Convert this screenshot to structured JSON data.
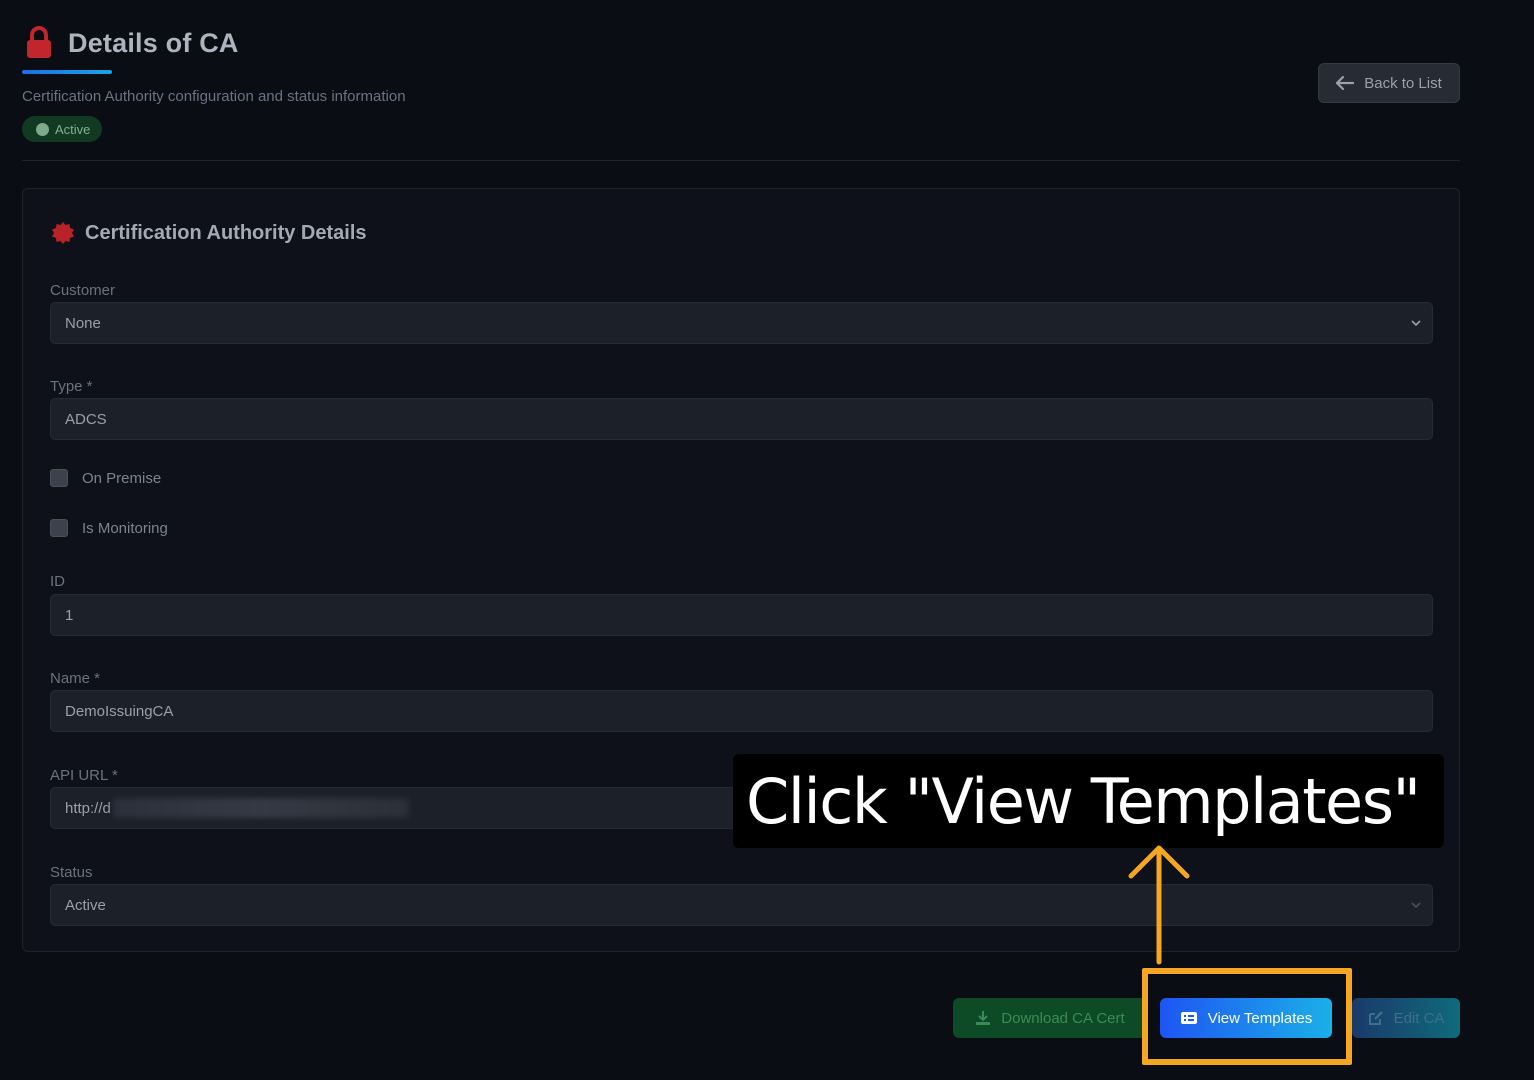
{
  "header": {
    "title": "Details of CA",
    "subtitle": "Certification Authority configuration and status information",
    "status_badge": "Active",
    "back_button": "Back to List"
  },
  "card": {
    "title": "Certification Authority Details",
    "fields": {
      "customer": {
        "label": "Customer",
        "value": "None"
      },
      "type": {
        "label": "Type *",
        "value": "ADCS"
      },
      "on_premise": {
        "label": "On Premise"
      },
      "is_monitoring": {
        "label": "Is Monitoring"
      },
      "id": {
        "label": "ID",
        "value": "1"
      },
      "name": {
        "label": "Name *",
        "value": "DemoIssuingCA"
      },
      "api_url": {
        "label": "API URL *",
        "value": "http://d"
      },
      "status": {
        "label": "Status",
        "value": "Active"
      }
    }
  },
  "actions": {
    "download": "Download CA Cert",
    "templates": "View Templates",
    "edit": "Edit CA"
  },
  "annotation": {
    "callout_text": "Click \"View Templates\""
  },
  "colors": {
    "lock": "#c0262c",
    "accent": "#1f6fe5",
    "highlight": "#f5a623"
  },
  "icons": [
    "lock-icon",
    "certificate-icon",
    "arrow-left-icon",
    "chevron-down-icon",
    "download-icon",
    "list-icon",
    "edit-icon"
  ]
}
